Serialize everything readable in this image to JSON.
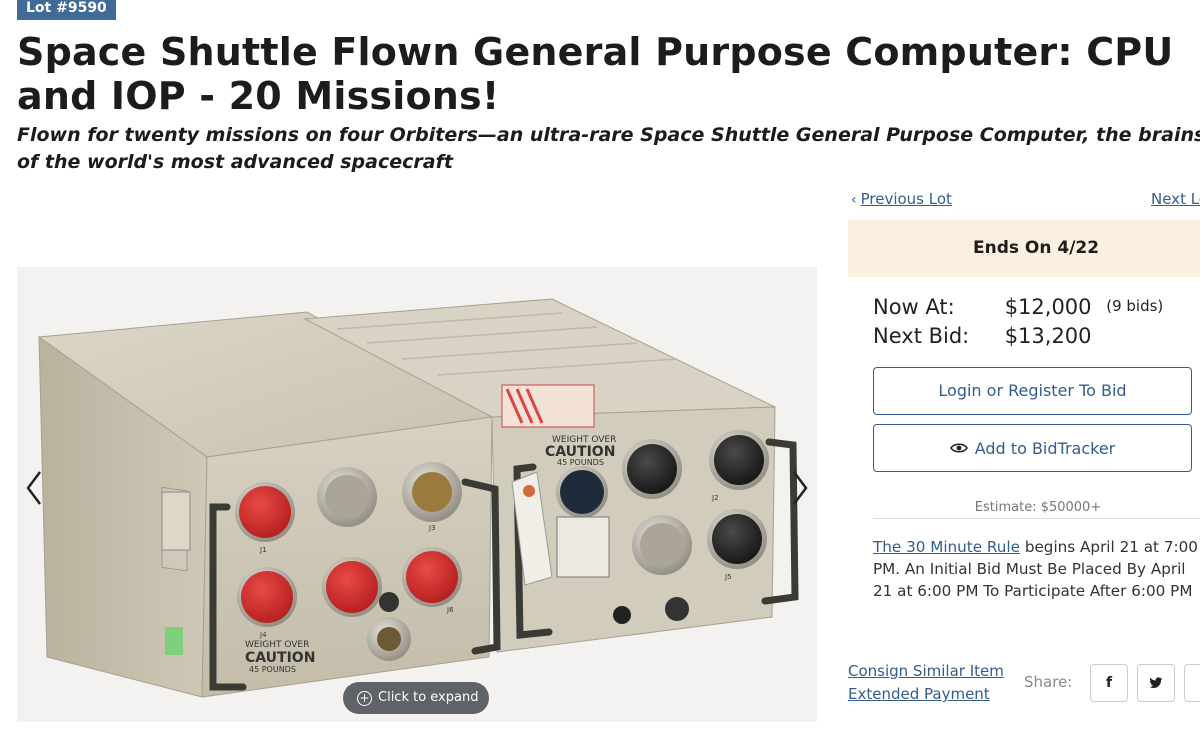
{
  "lot": {
    "badge": "Lot #9590"
  },
  "title_line1": "Space Shuttle Flown General Purpose Computer: CPU",
  "title_line2": "and IOP - 20 Missions!",
  "subtitle_line1": "Flown for twenty missions on four Orbiters—an ultra-rare Space Shuttle General Purpose Computer, the brains",
  "subtitle_line2": "of the world's most advanced spacecraft",
  "gallery": {
    "expand_label": "Click to expand",
    "left_icon": "chevron-left-icon",
    "right_icon": "chevron-right-icon",
    "unit_labels": {
      "caution_left": "CAUTION",
      "caution_right": "CAUTION",
      "weight_left": "WEIGHT OVER",
      "weight_right": "WEIGHT OVER",
      "pounds_left": "45 POUNDS",
      "pounds_right": "45 POUNDS",
      "j1": "J1",
      "j2": "J2",
      "j3": "J3",
      "j4": "J4",
      "j5": "J5",
      "j6": "J6"
    }
  },
  "nav": {
    "prev": "Previous Lot",
    "next": "Next Lot"
  },
  "auction": {
    "ends": "Ends On 4/22",
    "now_label": "Now At:",
    "now_value": "$12,000",
    "bids": "(9 bids)",
    "next_label": "Next Bid:",
    "next_value": "$13,200",
    "login_btn": "Login or Register To Bid",
    "tracker_btn": "Add to BidTracker",
    "estimate": "Estimate: $50000+",
    "rule_link": "The 30 Minute Rule",
    "rule_text": " begins April 21 at 7:00 PM. An Initial Bid Must Be Placed By April 21 at 6:00 PM To Participate After 6:00 PM"
  },
  "links": {
    "consign": "Consign Similar Item",
    "payment": "Extended Payment"
  },
  "share": {
    "label": "Share:",
    "icons": [
      "facebook-icon",
      "twitter-icon",
      "email-icon"
    ]
  },
  "colors": {
    "accent": "#335c8f",
    "badge": "#3f6b96",
    "ends_bg": "#fbf0e0",
    "cap_red": "#d42a2a"
  }
}
